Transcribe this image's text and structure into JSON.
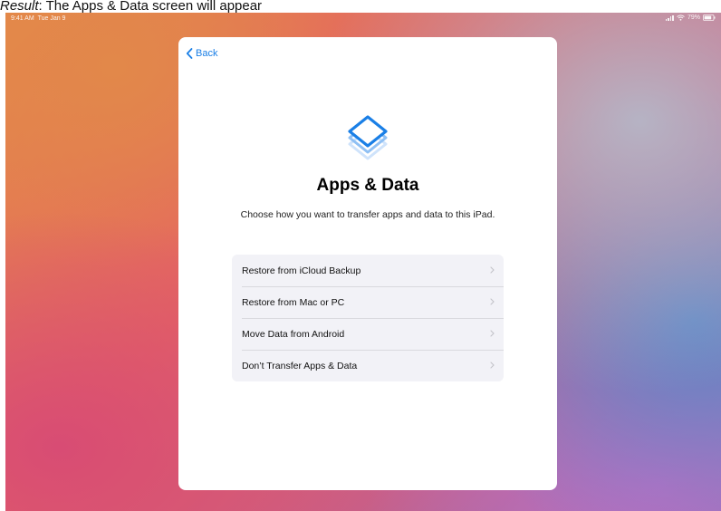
{
  "caption": {
    "lead": "Result",
    "text": ": The Apps & Data screen will appear"
  },
  "status_bar": {
    "time": "9:41 AM",
    "date": "Tue Jan 9",
    "battery": "79%"
  },
  "card": {
    "back_label": "Back",
    "title": "Apps & Data",
    "subtitle": "Choose how you want to transfer apps and data to this iPad.",
    "options": [
      {
        "label": "Restore from iCloud Backup"
      },
      {
        "label": "Restore from Mac or PC"
      },
      {
        "label": "Move Data from Android"
      },
      {
        "label": "Don’t Transfer Apps & Data"
      }
    ]
  },
  "colors": {
    "accent": "#1a7fe6",
    "list_background": "#f2f2f7"
  },
  "icons": {
    "header": "stacked-layers-icon",
    "back": "chevron-left-icon",
    "row": "chevron-right-icon"
  }
}
